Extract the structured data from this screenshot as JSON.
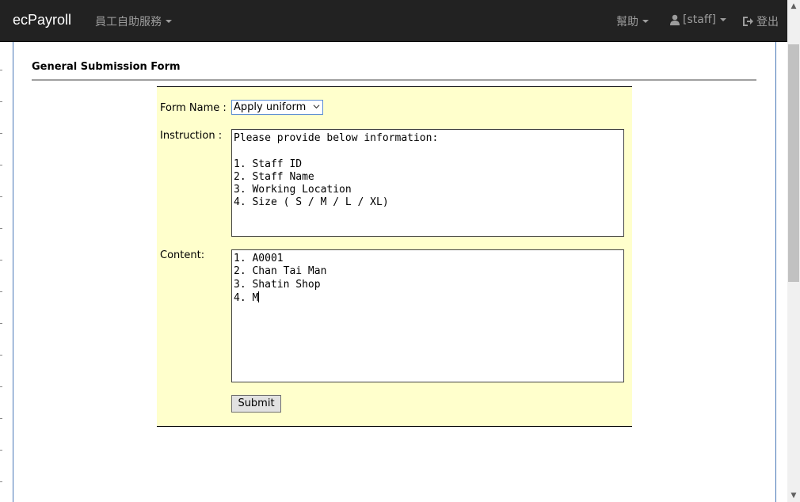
{
  "navbar": {
    "brand": "ecPayroll",
    "menu_ess": "員工自助服務",
    "menu_help": "幫助",
    "menu_user": "[staff]",
    "menu_logout": "登出",
    "icons": {
      "user": "user-icon",
      "logout": "logout-icon"
    }
  },
  "form": {
    "title": "General Submission Form",
    "form_name_label": "Form Name :",
    "form_name_value": "Apply uniform",
    "instruction_label": "Instruction :",
    "instruction_text": "Please provide below information:\n\n1. Staff ID\n2. Staff Name\n3. Working Location\n4. Size ( S / M / L / XL)",
    "content_label": "Content:",
    "content_text": "1. A0001\n2. Chan Tai Man\n3. Shatin Shop\n4. M",
    "submit_label": "Submit"
  },
  "colors": {
    "navbar_bg": "#222222",
    "form_bg": "#ffffcc",
    "focus_border": "#5d8ed4"
  }
}
